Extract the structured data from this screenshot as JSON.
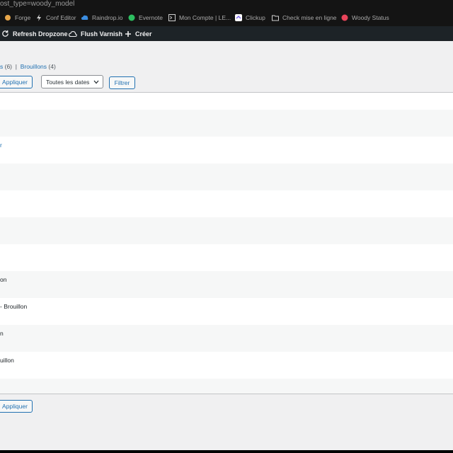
{
  "browser": {
    "url_fragment": "ost_type=woody_model",
    "bookmarks": [
      {
        "label": "Forge",
        "icon": "flame-icon"
      },
      {
        "label": "Conf Editor",
        "icon": "bolt-icon"
      },
      {
        "label": "Raindrop.io",
        "icon": "cloud-icon"
      },
      {
        "label": "Evernote",
        "icon": "elephant-icon"
      },
      {
        "label": "Mon Compte | LE...",
        "icon": "terminal-icon"
      },
      {
        "label": "Clickup",
        "icon": "clickup-icon"
      },
      {
        "label": "Check mise en ligne",
        "icon": "folder-icon"
      },
      {
        "label": "Woody Status",
        "icon": "status-icon"
      }
    ]
  },
  "adminbar": {
    "refresh_label": "Refresh Dropzone",
    "flush_label": "Flush Varnish",
    "create_label": "Créer"
  },
  "subsubsub": {
    "prev_partial": "s",
    "prev_count": "(6)",
    "separator": "|",
    "drafts_label": "Brouillons",
    "drafts_count": "(4)"
  },
  "filters": {
    "apply_label": "Appliquer",
    "dates_label": "Toutes les dates",
    "filter_label": "Filtrer"
  },
  "rows": [
    {
      "title": ""
    },
    {
      "title": ""
    },
    {
      "title": "r"
    },
    {
      "title": ""
    },
    {
      "title": ""
    },
    {
      "title": ""
    },
    {
      "title": ""
    },
    {
      "title": "on"
    },
    {
      "title": "- Brouillon"
    },
    {
      "title": "n"
    },
    {
      "title": "uillon"
    },
    {
      "title": ""
    }
  ],
  "bottom": {
    "apply_label": "Appliquer"
  },
  "colors": {
    "link": "#2271b1",
    "adminbar": "#1d2327",
    "background": "#f0f0f1"
  }
}
